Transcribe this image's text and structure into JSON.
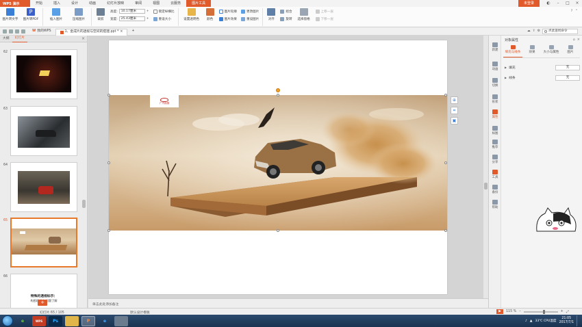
{
  "app": {
    "name": "WPS 演示",
    "login": "未登录"
  },
  "menu": [
    "开始",
    "插入",
    "设计",
    "动画",
    "幻灯片放映",
    "审阅",
    "视图",
    "云服务",
    "图片工具"
  ],
  "active_menu_index": 8,
  "ribbon": {
    "pic_to_text": "图片转文字",
    "pic_to_pdf": "图片转PDF",
    "insert_pic": "插入图片",
    "compress_pic": "压缩图片",
    "crop": "裁剪",
    "height_label": "高度:",
    "height_value": "10.17厘米",
    "width_label": "宽度:",
    "width_value": "25.43厘米",
    "lock_ratio": "锁定纵横比",
    "reset_size": "重设大小",
    "transparent": "设置透明色",
    "color": "颜色",
    "pic_outline": "图片轮廓",
    "pic_effect": "图片效果",
    "change_pic": "更改图片",
    "reset_pic": "重设图片",
    "align": "对齐",
    "group": "组合",
    "rotate": "旋转",
    "select_pane": "选择窗格",
    "up_layer": "上移一层",
    "down_layer": "下移一层"
  },
  "docbar": {
    "tabs": [
      "我的WPS",
      "1、金成片的透视与空间的搭建.ppt *"
    ],
    "search_placeholder": "点此查找命令"
  },
  "left_panel": {
    "tabs": [
      "大纲",
      "幻灯片"
    ],
    "slides": [
      {
        "num": "62",
        "caption": ""
      },
      {
        "num": "63",
        "caption": ""
      },
      {
        "num": "64",
        "caption": ""
      },
      {
        "num": "65",
        "caption": ""
      },
      {
        "num": "66",
        "caption": "特殊的透视标示：",
        "caption2": "构图理适应 问题了解"
      }
    ],
    "active_slide": "65"
  },
  "slide": {
    "logo_text": "广汽传祺"
  },
  "notes": {
    "placeholder": "单击此处添加备注"
  },
  "right_panel": {
    "title": "对象属性",
    "vertical": [
      "新建",
      "动画",
      "切换",
      "形状",
      "属性",
      "样图",
      "推荐",
      "分享",
      "工具",
      "备份",
      "帮助"
    ],
    "prop_tabs": [
      "填充与线条",
      "效果",
      "大小与属性",
      "图片"
    ],
    "rows": [
      {
        "label": "填充",
        "value": "无"
      },
      {
        "label": "线条",
        "value": "无"
      }
    ]
  },
  "status": {
    "slide_info": "幻灯片 65 / 105",
    "template": "默认设计模板",
    "zoom": "115 %"
  },
  "taskbar": {
    "apps": [
      "e",
      "WPS",
      "Ps",
      "",
      "P",
      "e",
      ""
    ],
    "tray_temp": "33℃",
    "tray_cpu": "CPU温度",
    "time": "21:05",
    "date": "2017/7/1"
  },
  "colors": {
    "accent": "#e05a2b",
    "title_bg": "#f3f3f3"
  }
}
